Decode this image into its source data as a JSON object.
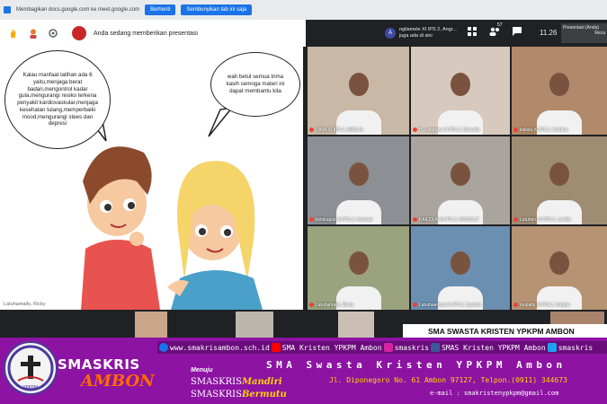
{
  "share_bar": {
    "text": "Membagikan docs.google.com ke meet.google.com",
    "stop_label": "Berhenti",
    "hide_label": "Sembunyikan tab ini saja"
  },
  "toolbar": {
    "presenting_text": "Anda sedang memberikan presentasi"
  },
  "slide": {
    "boy_bubble": "Kalau manfaat latihan ada 6 yaitu,menjaga berat badan,mengontrol kadar gula,mengurangi resiko terkena penyakit kardiovaskular,menjaga kesehatan tulang,memperbaiki mood,mengurangi stees dan depresi",
    "girl_bubble": "wah betul semua trima kasih semoga materi ini dapat membantu kita",
    "caption": "Latuhamallo, Ricky"
  },
  "notification": {
    "avatar_letter": "A",
    "text": "ngilamele XI IPS 2, Angr... juga ada di sini"
  },
  "top_tools": {
    "participants_badge": "57",
    "clock": "11.26",
    "presenter_chip": "Presentasi (Anda)",
    "presenter_name": "Reca"
  },
  "participants": [
    {
      "name": "DIMA XI IPS 2, AMELIA",
      "bg": "#c9b8a6"
    },
    {
      "name": "H. Latuheru XI IPS 2, Sherafia",
      "bg": "#d7c9bd"
    },
    {
      "name": "kailola XI IPS 2, Cristina",
      "bg": "#b08a6a"
    },
    {
      "name": "kolekupun XI IPS 2, Imanuel",
      "bg": "#8c8f93"
    },
    {
      "name": "KAILOLA XII IPS 2, KRISCLIT",
      "bg": "#a9a59e"
    },
    {
      "name": "Latuheru XI IPS 2, Junitlo",
      "bg": "#9e8c73"
    },
    {
      "name": "Latuhamallo, Ricky",
      "bg": "#9aa27e"
    },
    {
      "name": "Latumaerissa XI IPS 2, Suzima",
      "bg": "#6b8fb0"
    },
    {
      "name": "loupatty XI IPS 2, Natalia",
      "bg": "#b59373"
    }
  ],
  "banner": {
    "website": "www.smakrisambon.sch.id",
    "youtube": "SMA Kristen YPKPM Ambon",
    "instagram": "smaskris",
    "facebook": "SMAS Kristen YPKPM Ambon",
    "twitter": "smaskris",
    "brand_top": "SMASKRIS",
    "brand_bottom": "AMBON",
    "menuju": "Menuju",
    "mandiri_prefix": "SMASKRIS",
    "mandiri": "Mandiri",
    "bermutu_prefix": "SMASKRIS",
    "bermutu": "Bermutu",
    "school_name": "SMA Swasta Kristen YPKPM Ambon",
    "address": "Jl. Diponegoro  No. 61 Ambon 97127, Telpon.(0911) 344673",
    "email": "e-mail : smakristenypkpm@gmail.com",
    "corner_label": "SMA SWASTA KRISTEN YPKPM AMBON",
    "logo_text": "YPKPM"
  }
}
